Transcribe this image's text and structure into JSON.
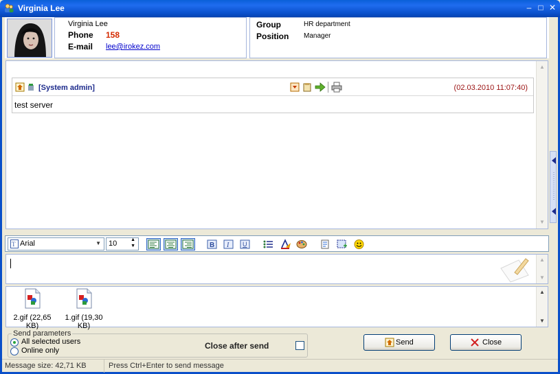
{
  "window": {
    "title": "Virginia Lee"
  },
  "contact": {
    "name": "Virginia Lee",
    "phone_label": "Phone",
    "phone": "158",
    "email_label": "E-mail",
    "email": "lee@irokez.com",
    "group_label": "Group",
    "group": "HR department",
    "position_label": "Position",
    "position": "Manager"
  },
  "messages": [
    {
      "sender": "[System admin]",
      "timestamp": "(02.03.2010 11:07:40)",
      "text": "test server"
    }
  ],
  "toolbar": {
    "font": "Arial",
    "size": "10",
    "icons": [
      "align-left-icon",
      "align-center-icon",
      "align-right-icon",
      "bold-icon",
      "italic-icon",
      "underline-icon",
      "bullet-list-icon",
      "text-color-icon",
      "background-color-icon",
      "insert-file-icon",
      "screenshot-icon",
      "smiley-icon"
    ]
  },
  "attachments": [
    {
      "name": "2.gif (22,65 KB)"
    },
    {
      "name": "1.gif (19,30 KB)"
    }
  ],
  "send_params": {
    "legend": "Send parameters",
    "option_all": "All selected users",
    "option_online": "Online only",
    "selected": "All selected users",
    "close_after_send_label": "Close after send",
    "close_after_send": false
  },
  "buttons": {
    "send": "Send",
    "close": "Close"
  },
  "status": {
    "size": "Message size: 42,71 KB",
    "hint": "Press Ctrl+Enter to send message"
  },
  "colors": {
    "titlebar": "#0a5fd8",
    "phone": "#d42a00",
    "sender": "#1d2b8c",
    "timestamp": "#9a1010",
    "link": "#0000cc"
  }
}
